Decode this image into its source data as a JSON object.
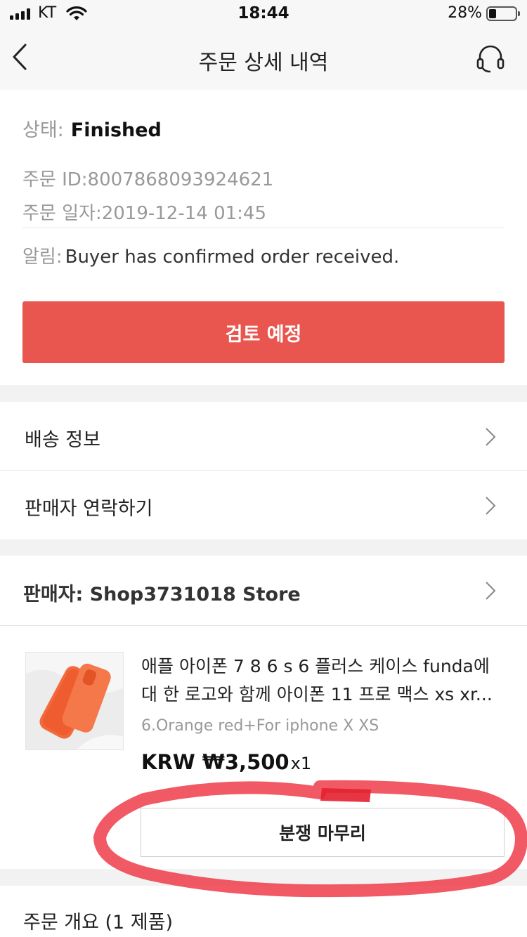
{
  "status_bar": {
    "carrier": "KT",
    "time": "18:44",
    "battery": "28%",
    "battery_level": 0.28,
    "signal_icon": "signal-bars-icon",
    "wifi_icon": "wifi-icon",
    "battery_icon": "battery-icon"
  },
  "nav": {
    "title": "주문 상세 내역",
    "back_icon": "chevron-left-icon",
    "support_icon": "headset-icon"
  },
  "order": {
    "status_label": "상태:",
    "status_value": "Finished",
    "id_text": "주문 ID:8007868093924621",
    "date_text": "주문 일자:2019-12-14 01:45",
    "notice_label": "알림:",
    "notice_value": "Buyer has confirmed order received.",
    "review_button": "검토 예정"
  },
  "menu": {
    "items": [
      {
        "label": "배송 정보"
      },
      {
        "label": "판매자 연락하기"
      }
    ]
  },
  "seller": {
    "label": "판매자: Shop3731018 Store"
  },
  "product": {
    "title": "애플 아이폰 7 8 6 s 6 플러스 케이스 funda에 대 한 로고와 함께 아이폰 11 프로 맥스 xs xr...",
    "variant": "6.Orange red+For iphone X XS",
    "price": "KRW ₩3,500",
    "quantity": "x1",
    "dispute_button": "분쟁 마무리"
  },
  "summary": {
    "label": "주문 개요 (1 제품)"
  },
  "colors": {
    "primary_button": "#e8564f",
    "annotation": "#ee3c4a"
  }
}
